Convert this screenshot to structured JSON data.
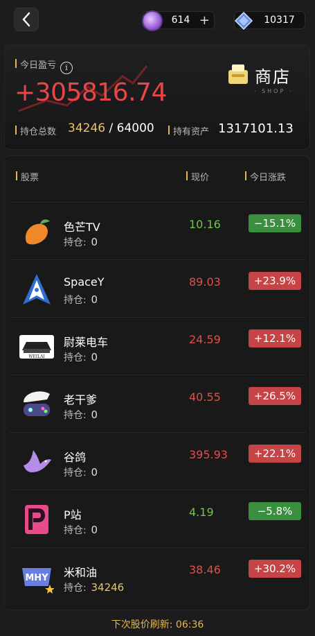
{
  "currencies": {
    "gem": "614",
    "crystal": "10317",
    "plus": "+"
  },
  "summary": {
    "today_pl_label": "今日盈亏",
    "today_pl": "+305816.74",
    "shop_label": "商店",
    "shop_sub": "· SHOP ·",
    "holdings_label": "持仓总数",
    "holdings_value": "34246",
    "holdings_sep": "/",
    "holdings_max": "64000",
    "assets_label": "持有资产",
    "assets_value": "1317101.13"
  },
  "table": {
    "col_stock": "股票",
    "col_price": "现价",
    "col_change": "今日涨跌",
    "hold_label": "持仓:",
    "rows": [
      {
        "name": "色芒TV",
        "hold": "0",
        "price": "10.16",
        "change": "−15.1%",
        "dir": "down",
        "logo": "mango-icon"
      },
      {
        "name": "SpaceY",
        "hold": "0",
        "price": "89.03",
        "change": "+23.9%",
        "dir": "up",
        "logo": "rocket-icon"
      },
      {
        "name": "尉莱电车",
        "hold": "0",
        "price": "24.59",
        "change": "+12.1%",
        "dir": "up",
        "logo": "car-icon",
        "logo_text": "WEILAI"
      },
      {
        "name": "老干爹",
        "hold": "0",
        "price": "40.55",
        "change": "+26.5%",
        "dir": "up",
        "logo": "gamer-icon"
      },
      {
        "name": "谷鸽",
        "hold": "0",
        "price": "395.93",
        "change": "+22.1%",
        "dir": "up",
        "logo": "dove-icon"
      },
      {
        "name": "P站",
        "hold": "0",
        "price": "4.19",
        "change": "−5.8%",
        "dir": "down",
        "logo": "p-site-icon"
      },
      {
        "name": "米和油",
        "hold": "34246",
        "price": "38.46",
        "change": "+30.2%",
        "dir": "up",
        "logo": "mhy-icon",
        "logo_text": "MHY"
      }
    ]
  },
  "footer": {
    "label": "下次股价刷新:",
    "time": "06:36"
  },
  "colors": {
    "up": "#c64446",
    "down": "#3a8f3e",
    "accent": "#e5b84a",
    "price_up": "#e0504a",
    "price_down": "#6fc64a"
  }
}
